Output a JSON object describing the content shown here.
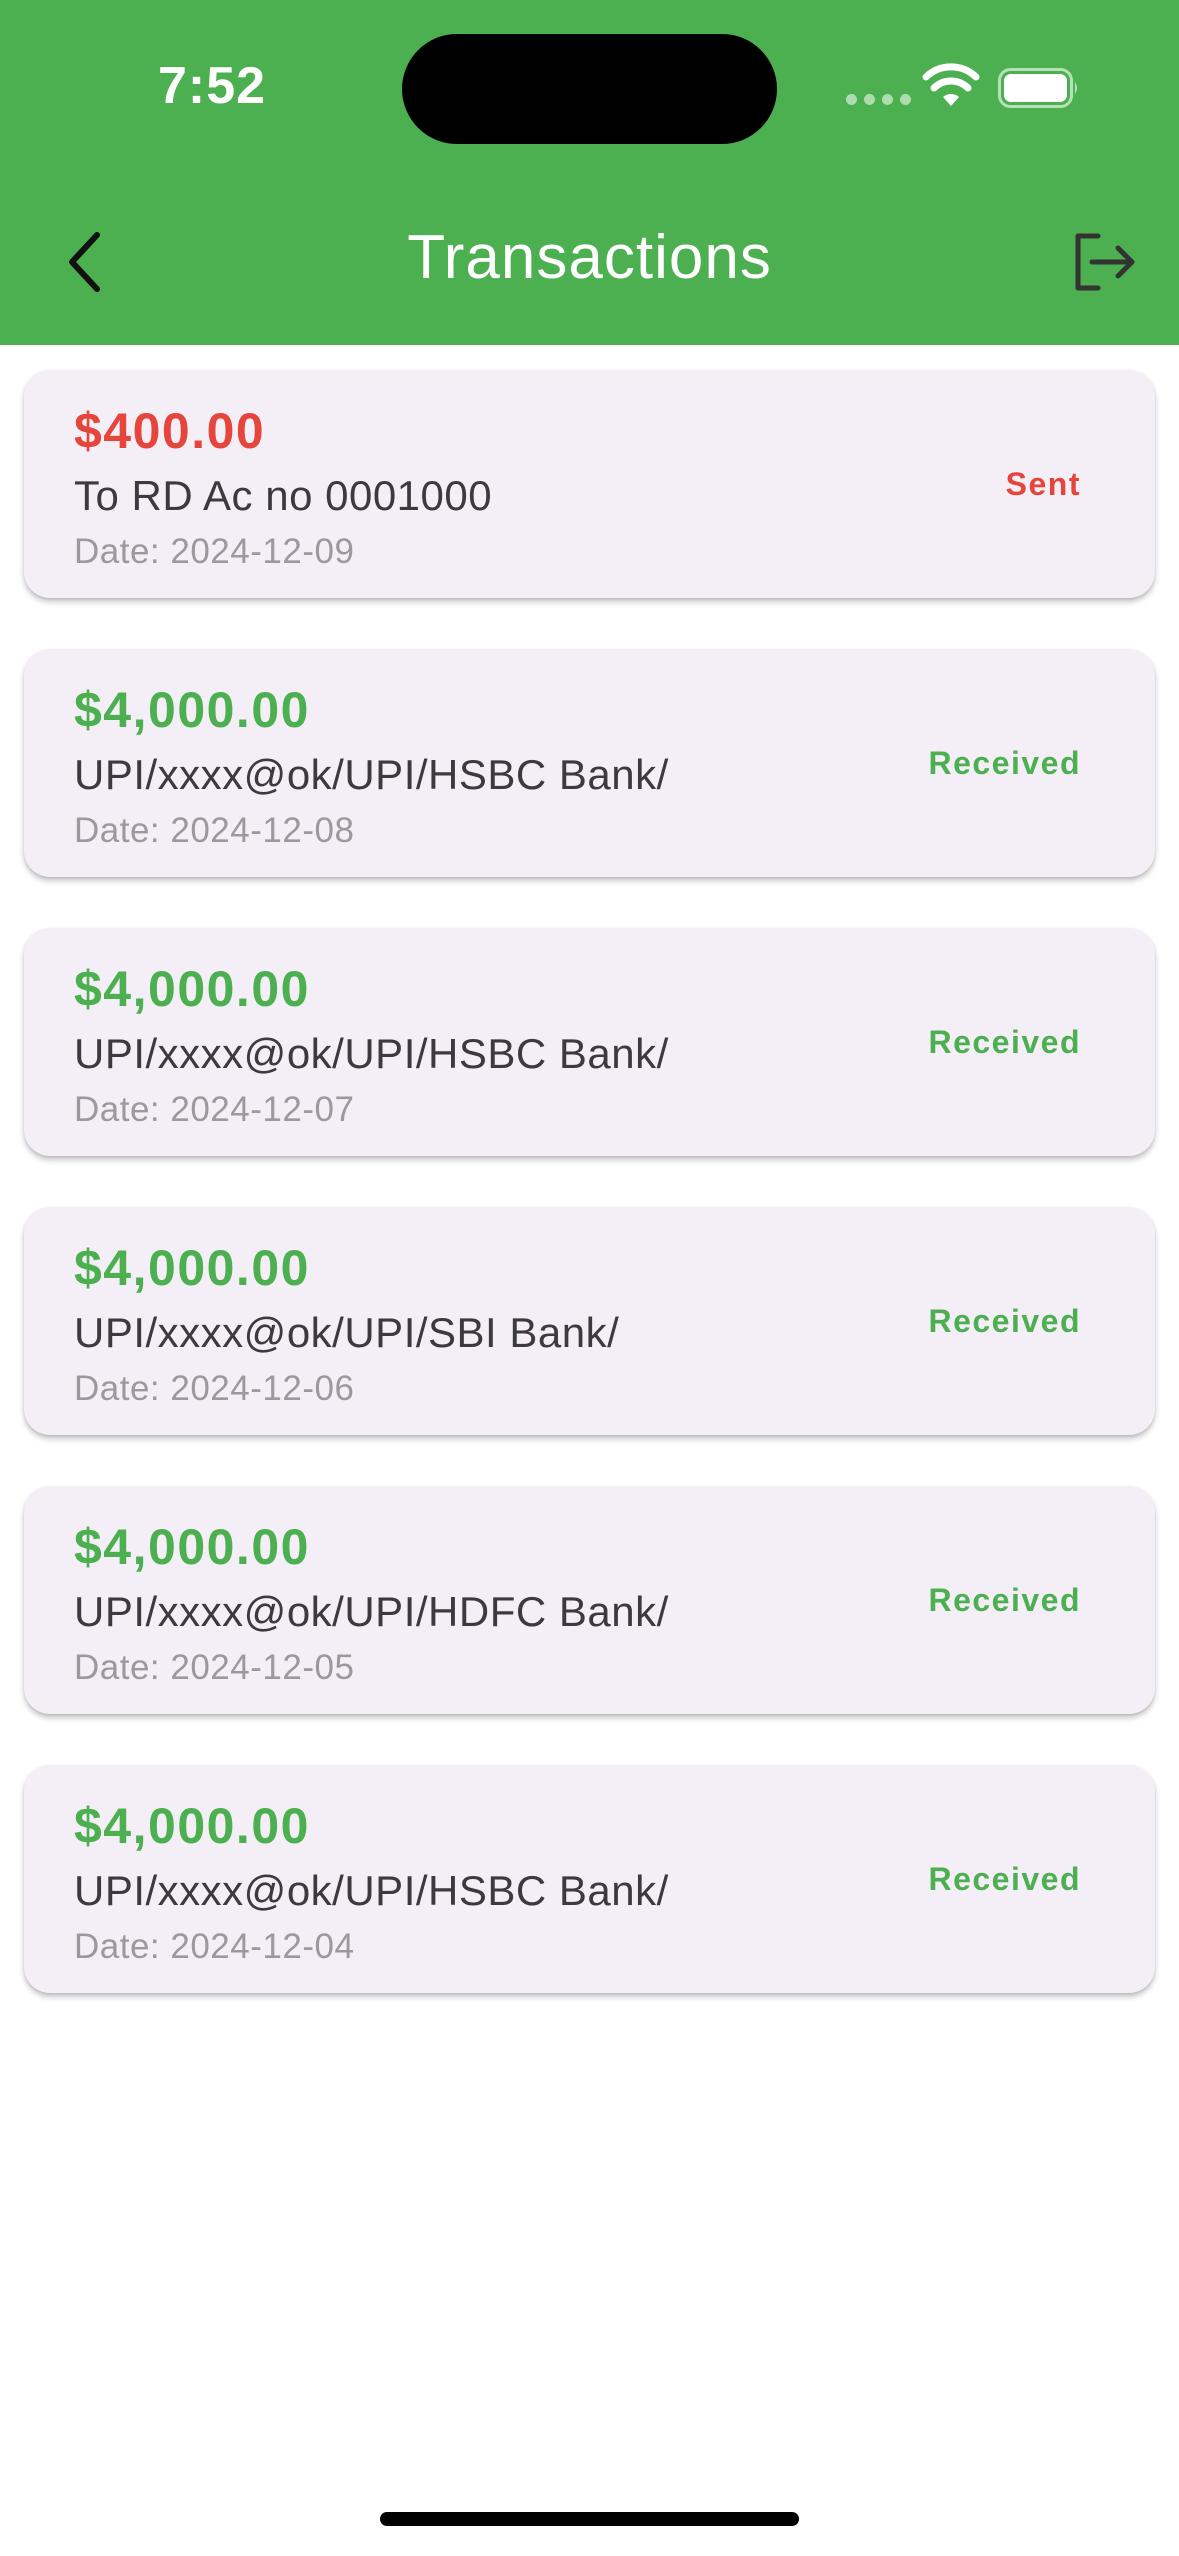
{
  "status_bar": {
    "time": "7:52"
  },
  "app_bar": {
    "title": "Transactions",
    "back_icon": "chevron-left-icon",
    "logout_icon": "logout-icon"
  },
  "colors": {
    "header_bg": "#4caf50",
    "sent": "#e5453a",
    "received": "#4caf50",
    "card_bg": "#f4eff7"
  },
  "transactions": [
    {
      "amount": "$400.00",
      "description": "To RD Ac no 0001000",
      "date": "Date: 2024-12-09",
      "status": "Sent",
      "type": "sent"
    },
    {
      "amount": "$4,000.00",
      "description": "UPI/xxxx@ok/UPI/HSBC Bank/",
      "date": "Date: 2024-12-08",
      "status": "Received",
      "type": "received"
    },
    {
      "amount": "$4,000.00",
      "description": "UPI/xxxx@ok/UPI/HSBC Bank/",
      "date": "Date: 2024-12-07",
      "status": "Received",
      "type": "received"
    },
    {
      "amount": "$4,000.00",
      "description": "UPI/xxxx@ok/UPI/SBI Bank/",
      "date": "Date: 2024-12-06",
      "status": "Received",
      "type": "received"
    },
    {
      "amount": "$4,000.00",
      "description": "UPI/xxxx@ok/UPI/HDFC Bank/",
      "date": "Date: 2024-12-05",
      "status": "Received",
      "type": "received"
    },
    {
      "amount": "$4,000.00",
      "description": "UPI/xxxx@ok/UPI/HSBC Bank/",
      "date": "Date: 2024-12-04",
      "status": "Received",
      "type": "received"
    }
  ]
}
